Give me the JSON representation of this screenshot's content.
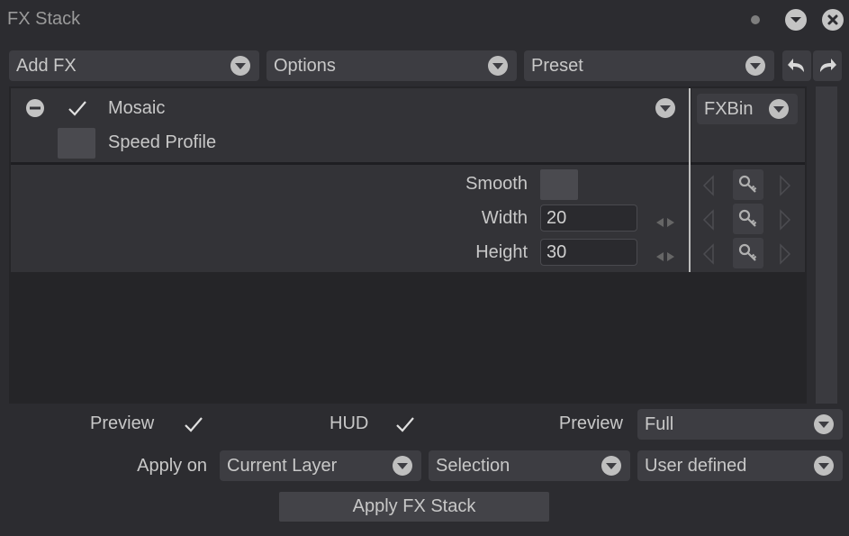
{
  "window": {
    "title": "FX Stack"
  },
  "toolbar": {
    "add_fx": "Add FX",
    "options": "Options",
    "preset": "Preset"
  },
  "fx": {
    "name": "Mosaic",
    "speed_profile": "Speed Profile",
    "bin": "FXBin",
    "params": {
      "smooth_label": "Smooth",
      "width_label": "Width",
      "width_value": "20",
      "height_label": "Height",
      "height_value": "30"
    }
  },
  "footer": {
    "preview_label": "Preview",
    "hud_label": "HUD",
    "preview_mode_label": "Preview",
    "preview_mode_value": "Full",
    "apply_on_label": "Apply on",
    "apply_on_layer": "Current Layer",
    "apply_on_selection": "Selection",
    "apply_on_range": "User defined",
    "apply_button": "Apply FX Stack"
  },
  "icons": {
    "check": "check-icon",
    "remove": "minus-circle-icon",
    "key": "key-icon",
    "undo": "undo-icon",
    "redo": "redo-icon"
  },
  "colors": {
    "background": "#2c2c30",
    "panel": "#252528",
    "control": "#3d3d42",
    "text": "#c8c8c8"
  }
}
